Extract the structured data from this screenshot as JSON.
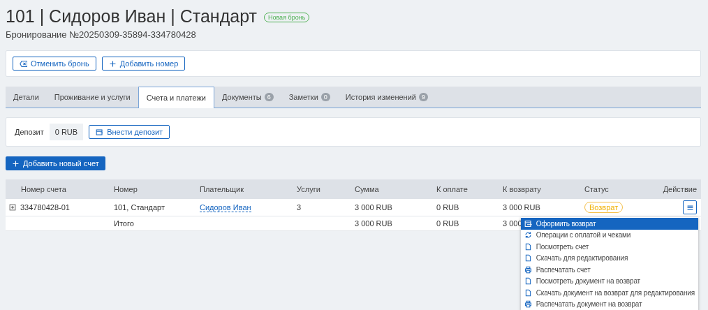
{
  "header": {
    "title": "101 | Сидоров Иван | Стандарт",
    "tag": "Новая бронь",
    "subtitle": "Бронирование №20250309-35894-334780428"
  },
  "actions": [
    {
      "kind": "cancel",
      "label": "Отменить бронь"
    },
    {
      "kind": "add",
      "label": "Добавить номер"
    }
  ],
  "tabs": [
    {
      "label": "Детали",
      "selected": false
    },
    {
      "label": "Проживание и услуги",
      "selected": false
    },
    {
      "label": "Счета и платежи",
      "selected": true
    },
    {
      "label": "Документы",
      "count": "6",
      "selected": false
    },
    {
      "label": "Заметки",
      "count": "0",
      "selected": false
    },
    {
      "label": "История изменений",
      "count": "9",
      "selected": false
    }
  ],
  "deposit": {
    "label": "Депозит",
    "value": "0 RUB",
    "button": "Внести депозит"
  },
  "add_invoice_button": "Добавить новый счет",
  "table": {
    "columns": [
      "Номер счета",
      "Номер",
      "Плательщик",
      "Услуги",
      "Сумма",
      "К оплате",
      "К возврату",
      "Статус",
      "Действие"
    ],
    "rows": [
      {
        "cells": [
          "334780428-01",
          "101, Стандарт",
          "Сидоров Иван",
          "3",
          "3 000 RUB",
          "0 RUB",
          "3 000 RUB"
        ],
        "status": "Возврат",
        "expanded": false
      }
    ],
    "total": {
      "label": "Итого",
      "cells": [
        "3 000 RUB",
        "0 RUB",
        "3 000"
      ]
    }
  },
  "menu": [
    {
      "kind": "return",
      "label": "Оформить возврат",
      "selected": true
    },
    {
      "kind": "refresh",
      "label": "Операции с оплатой и чеками",
      "selected": false
    },
    {
      "kind": "doc",
      "label": "Посмотреть счет",
      "selected": false
    },
    {
      "kind": "doc",
      "label": "Скачать для редактирования",
      "selected": false
    },
    {
      "kind": "print",
      "label": "Распечатать счет",
      "selected": false
    },
    {
      "kind": "doc",
      "label": "Посмотреть документ на возврат",
      "selected": false
    },
    {
      "kind": "doc",
      "label": "Скачать документ на возврат для редактирования",
      "selected": false
    },
    {
      "kind": "print",
      "label": "Распечатать документ на возврат",
      "selected": false
    }
  ]
}
